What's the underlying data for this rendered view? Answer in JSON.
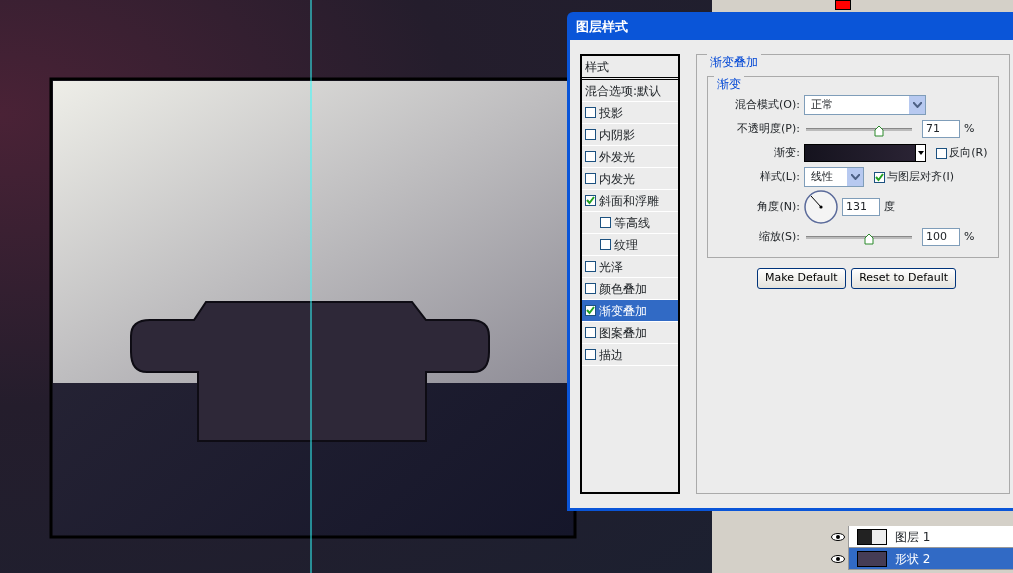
{
  "dialog": {
    "title": "图层样式",
    "styles_header": "样式",
    "styles": [
      {
        "label": "混合选项:默认",
        "kind": "plain",
        "selected": false
      },
      {
        "label": "投影",
        "kind": "check",
        "checked": false,
        "selected": false
      },
      {
        "label": "内阴影",
        "kind": "check",
        "checked": false,
        "selected": false
      },
      {
        "label": "外发光",
        "kind": "check",
        "checked": false,
        "selected": false
      },
      {
        "label": "内发光",
        "kind": "check",
        "checked": false,
        "selected": false
      },
      {
        "label": "斜面和浮雕",
        "kind": "check",
        "checked": true,
        "selected": false,
        "children": [
          {
            "label": "等高线",
            "kind": "check",
            "checked": false,
            "selected": false
          },
          {
            "label": "纹理",
            "kind": "check",
            "checked": false,
            "selected": false
          }
        ]
      },
      {
        "label": "光泽",
        "kind": "check",
        "checked": false,
        "selected": false
      },
      {
        "label": "颜色叠加",
        "kind": "check",
        "checked": false,
        "selected": false
      },
      {
        "label": "渐变叠加",
        "kind": "check",
        "checked": true,
        "selected": true
      },
      {
        "label": "图案叠加",
        "kind": "check",
        "checked": false,
        "selected": false
      },
      {
        "label": "描边",
        "kind": "check",
        "checked": false,
        "selected": false
      }
    ],
    "section_title": "渐变叠加",
    "group_title": "渐变",
    "blend_mode": {
      "label": "混合模式(O):",
      "value": "正常"
    },
    "opacity": {
      "label": "不透明度(P):",
      "level": 0.71,
      "value": "71",
      "unit": "%"
    },
    "gradient": {
      "label": "渐变:",
      "reverse": {
        "label": "反向(R)",
        "checked": false
      }
    },
    "style": {
      "label": "样式(L):",
      "value": "线性",
      "align": {
        "label": "与图层对齐(I)",
        "checked": true
      }
    },
    "angle": {
      "label": "角度(N):",
      "value": "131",
      "unit": "度"
    },
    "scale": {
      "label": "缩放(S):",
      "level": 0.6,
      "value": "100",
      "unit": "%"
    },
    "buttons": [
      "Make Default",
      "Reset to Default"
    ]
  },
  "layers": [
    {
      "name": "图层 1",
      "selected": false
    },
    {
      "name": "形状 2",
      "selected": true
    }
  ]
}
